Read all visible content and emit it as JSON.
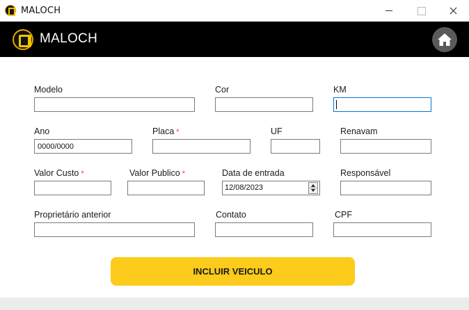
{
  "window": {
    "title": "MALOCH",
    "controls": [
      "minimize",
      "maximize",
      "close"
    ]
  },
  "header": {
    "brand": "MALOCH",
    "home_icon": "home-icon"
  },
  "form": {
    "modelo": {
      "label": "Modelo",
      "value": ""
    },
    "cor": {
      "label": "Cor",
      "value": ""
    },
    "km": {
      "label": "KM",
      "value": ""
    },
    "ano": {
      "label": "Ano",
      "value": "0000/0000"
    },
    "placa": {
      "label": "Placa",
      "required_mark": "*",
      "value": ""
    },
    "uf": {
      "label": "UF",
      "value": ""
    },
    "renavam": {
      "label": "Renavam",
      "value": ""
    },
    "valor_custo": {
      "label": "Valor Custo",
      "required_mark": "*",
      "value": ""
    },
    "valor_publico": {
      "label": "Valor Publico",
      "required_mark": "*",
      "value": ""
    },
    "data_entrada": {
      "label": "Data de entrada",
      "value": "12/08/2023"
    },
    "responsavel": {
      "label": "Responsável",
      "value": ""
    },
    "proprietario_anterior": {
      "label": "Proprietário anterior",
      "value": ""
    },
    "contato": {
      "label": "Contato",
      "value": ""
    },
    "cpf": {
      "label": "CPF",
      "value": ""
    },
    "submit_label": "INCLUIR VEICULO"
  },
  "colors": {
    "header_bg": "#000000",
    "accent": "#fccb1b",
    "required": "#e0443c",
    "focus_border": "#0078d7"
  }
}
